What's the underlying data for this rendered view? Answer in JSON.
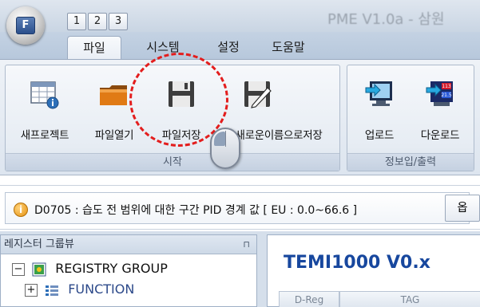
{
  "window": {
    "title": "PME V1.0a - 삼원",
    "app_button_letter": "F",
    "quick_access": [
      "1",
      "2",
      "3"
    ]
  },
  "tabs": [
    {
      "label": "파일",
      "active": true
    },
    {
      "label": "시스템",
      "active": false
    },
    {
      "label": "설정",
      "active": false
    },
    {
      "label": "도움말",
      "active": false
    }
  ],
  "ribbon": {
    "groups": [
      {
        "label": "시작",
        "buttons": [
          {
            "label": "새프로젝트",
            "icon": "new-project-icon"
          },
          {
            "label": "파일열기",
            "icon": "folder-open-icon"
          },
          {
            "label": "파일저장",
            "icon": "save-disk-icon"
          },
          {
            "label": "새로운이름으로저장",
            "icon": "save-as-icon"
          }
        ]
      },
      {
        "label": "정보입/출력",
        "buttons": [
          {
            "label": "업로드",
            "icon": "upload-icon"
          },
          {
            "label": "다운로드",
            "icon": "download-icon"
          }
        ]
      }
    ]
  },
  "message_bar": {
    "text": "D0705 : 습도 전 범위에 대한 구간 PID 경계 값 [ EU : 0.0~66.6 ]",
    "button_label": "옵"
  },
  "register_panel": {
    "title": "레지스터 그룹뷰",
    "tree": [
      {
        "label": "REGISTRY GROUP",
        "toggle": "−"
      },
      {
        "label": "FUNCTION",
        "toggle": "+"
      }
    ]
  },
  "device_panel": {
    "title": "TEMI1000 V0.x",
    "columns": [
      "D-Reg",
      "TAG"
    ]
  },
  "colors": {
    "accent_red": "#e31d1d",
    "title_blue": "#17479e",
    "ribbon_bg": "#dde5ef"
  }
}
